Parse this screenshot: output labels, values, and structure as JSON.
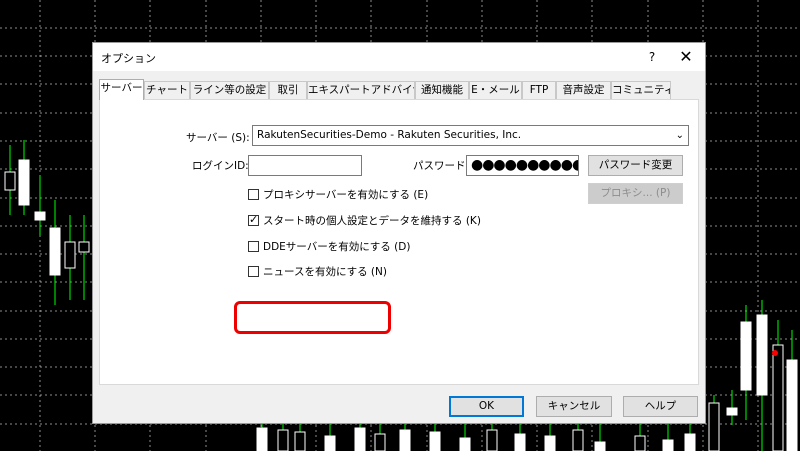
{
  "dialog": {
    "title": "オプション",
    "help_label": "?",
    "close_label": "✕"
  },
  "tabs": [
    {
      "label": "サーバー",
      "active": true
    },
    {
      "label": "チャート"
    },
    {
      "label": "ライン等の設定"
    },
    {
      "label": "取引"
    },
    {
      "label": "エキスパートアドバイザ"
    },
    {
      "label": "通知機能"
    },
    {
      "label": "E・メール"
    },
    {
      "label": "FTP"
    },
    {
      "label": "音声設定"
    },
    {
      "label": "コミュニティ"
    }
  ],
  "server": {
    "label": "サーバー (S):",
    "value": "RakutenSecurities-Demo - Rakuten Securities, Inc."
  },
  "login": {
    "label": "ログインID:",
    "value": ""
  },
  "password": {
    "label": "パスワード:",
    "value": "●●●●●●●●●●●",
    "change_button": "パスワード変更"
  },
  "proxy_button": "プロキシ... (P)",
  "checkboxes": [
    {
      "label": "プロキシサーバーを有効にする (E)",
      "checked": false
    },
    {
      "label": "スタート時の個人設定とデータを維持する (K)",
      "checked": true
    },
    {
      "label": "DDEサーバーを有効にする (D)",
      "checked": false
    },
    {
      "label": "ニュースを有効にする (N)",
      "checked": false
    }
  ],
  "footer": {
    "ok": "OK",
    "cancel": "キャンセル",
    "help": "ヘルプ"
  },
  "colors": {
    "chart_background": "#000000",
    "grid": "#ffffff",
    "bull_candle": "#ffffff",
    "wick": "#00ff00",
    "highlight": "#e00000",
    "marker": "#ff0000"
  }
}
